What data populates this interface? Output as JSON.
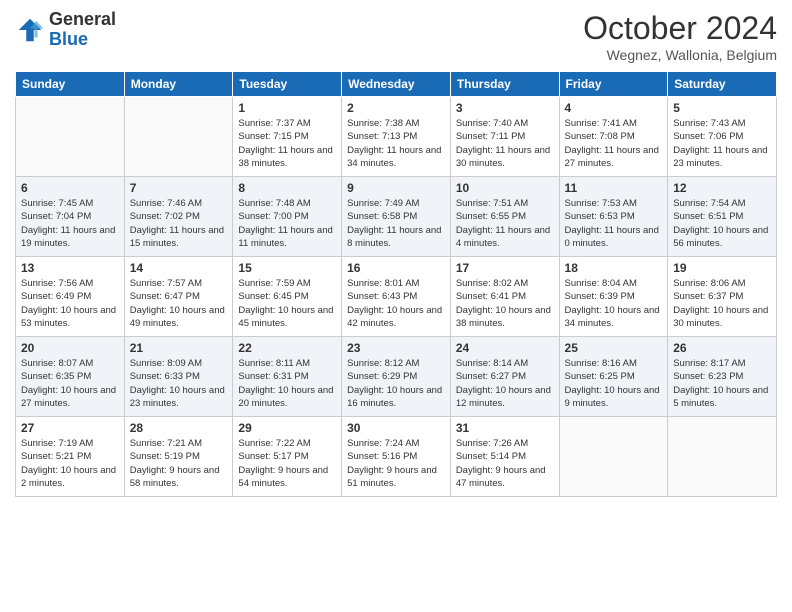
{
  "header": {
    "logo_general": "General",
    "logo_blue": "Blue",
    "month_title": "October 2024",
    "location": "Wegnez, Wallonia, Belgium"
  },
  "days_of_week": [
    "Sunday",
    "Monday",
    "Tuesday",
    "Wednesday",
    "Thursday",
    "Friday",
    "Saturday"
  ],
  "weeks": [
    [
      {
        "day": "",
        "info": ""
      },
      {
        "day": "",
        "info": ""
      },
      {
        "day": "1",
        "info": "Sunrise: 7:37 AM\nSunset: 7:15 PM\nDaylight: 11 hours and 38 minutes."
      },
      {
        "day": "2",
        "info": "Sunrise: 7:38 AM\nSunset: 7:13 PM\nDaylight: 11 hours and 34 minutes."
      },
      {
        "day": "3",
        "info": "Sunrise: 7:40 AM\nSunset: 7:11 PM\nDaylight: 11 hours and 30 minutes."
      },
      {
        "day": "4",
        "info": "Sunrise: 7:41 AM\nSunset: 7:08 PM\nDaylight: 11 hours and 27 minutes."
      },
      {
        "day": "5",
        "info": "Sunrise: 7:43 AM\nSunset: 7:06 PM\nDaylight: 11 hours and 23 minutes."
      }
    ],
    [
      {
        "day": "6",
        "info": "Sunrise: 7:45 AM\nSunset: 7:04 PM\nDaylight: 11 hours and 19 minutes."
      },
      {
        "day": "7",
        "info": "Sunrise: 7:46 AM\nSunset: 7:02 PM\nDaylight: 11 hours and 15 minutes."
      },
      {
        "day": "8",
        "info": "Sunrise: 7:48 AM\nSunset: 7:00 PM\nDaylight: 11 hours and 11 minutes."
      },
      {
        "day": "9",
        "info": "Sunrise: 7:49 AM\nSunset: 6:58 PM\nDaylight: 11 hours and 8 minutes."
      },
      {
        "day": "10",
        "info": "Sunrise: 7:51 AM\nSunset: 6:55 PM\nDaylight: 11 hours and 4 minutes."
      },
      {
        "day": "11",
        "info": "Sunrise: 7:53 AM\nSunset: 6:53 PM\nDaylight: 11 hours and 0 minutes."
      },
      {
        "day": "12",
        "info": "Sunrise: 7:54 AM\nSunset: 6:51 PM\nDaylight: 10 hours and 56 minutes."
      }
    ],
    [
      {
        "day": "13",
        "info": "Sunrise: 7:56 AM\nSunset: 6:49 PM\nDaylight: 10 hours and 53 minutes."
      },
      {
        "day": "14",
        "info": "Sunrise: 7:57 AM\nSunset: 6:47 PM\nDaylight: 10 hours and 49 minutes."
      },
      {
        "day": "15",
        "info": "Sunrise: 7:59 AM\nSunset: 6:45 PM\nDaylight: 10 hours and 45 minutes."
      },
      {
        "day": "16",
        "info": "Sunrise: 8:01 AM\nSunset: 6:43 PM\nDaylight: 10 hours and 42 minutes."
      },
      {
        "day": "17",
        "info": "Sunrise: 8:02 AM\nSunset: 6:41 PM\nDaylight: 10 hours and 38 minutes."
      },
      {
        "day": "18",
        "info": "Sunrise: 8:04 AM\nSunset: 6:39 PM\nDaylight: 10 hours and 34 minutes."
      },
      {
        "day": "19",
        "info": "Sunrise: 8:06 AM\nSunset: 6:37 PM\nDaylight: 10 hours and 30 minutes."
      }
    ],
    [
      {
        "day": "20",
        "info": "Sunrise: 8:07 AM\nSunset: 6:35 PM\nDaylight: 10 hours and 27 minutes."
      },
      {
        "day": "21",
        "info": "Sunrise: 8:09 AM\nSunset: 6:33 PM\nDaylight: 10 hours and 23 minutes."
      },
      {
        "day": "22",
        "info": "Sunrise: 8:11 AM\nSunset: 6:31 PM\nDaylight: 10 hours and 20 minutes."
      },
      {
        "day": "23",
        "info": "Sunrise: 8:12 AM\nSunset: 6:29 PM\nDaylight: 10 hours and 16 minutes."
      },
      {
        "day": "24",
        "info": "Sunrise: 8:14 AM\nSunset: 6:27 PM\nDaylight: 10 hours and 12 minutes."
      },
      {
        "day": "25",
        "info": "Sunrise: 8:16 AM\nSunset: 6:25 PM\nDaylight: 10 hours and 9 minutes."
      },
      {
        "day": "26",
        "info": "Sunrise: 8:17 AM\nSunset: 6:23 PM\nDaylight: 10 hours and 5 minutes."
      }
    ],
    [
      {
        "day": "27",
        "info": "Sunrise: 7:19 AM\nSunset: 5:21 PM\nDaylight: 10 hours and 2 minutes."
      },
      {
        "day": "28",
        "info": "Sunrise: 7:21 AM\nSunset: 5:19 PM\nDaylight: 9 hours and 58 minutes."
      },
      {
        "day": "29",
        "info": "Sunrise: 7:22 AM\nSunset: 5:17 PM\nDaylight: 9 hours and 54 minutes."
      },
      {
        "day": "30",
        "info": "Sunrise: 7:24 AM\nSunset: 5:16 PM\nDaylight: 9 hours and 51 minutes."
      },
      {
        "day": "31",
        "info": "Sunrise: 7:26 AM\nSunset: 5:14 PM\nDaylight: 9 hours and 47 minutes."
      },
      {
        "day": "",
        "info": ""
      },
      {
        "day": "",
        "info": ""
      }
    ]
  ]
}
